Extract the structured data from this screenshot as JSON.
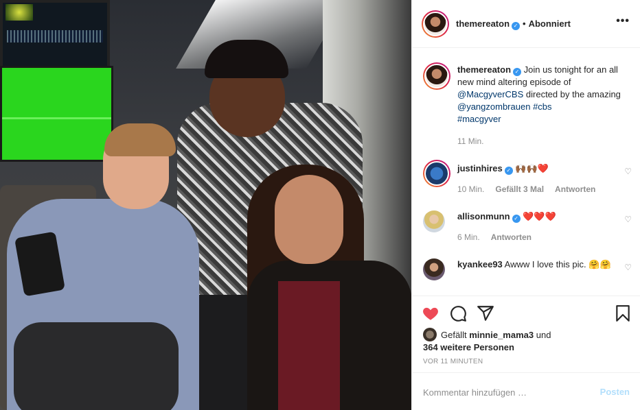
{
  "header": {
    "username": "themereaton",
    "separator": "•",
    "follow_status": "Abonniert",
    "more": "•••"
  },
  "caption": {
    "username": "themereaton",
    "text_1": " Join us tonight for an all new mind altering episode of ",
    "mention_1": "@MacgyverCBS",
    "text_2": " directed by the amazing ",
    "mention_2": "@yangzombrauen",
    "text_3": " ",
    "hashtag_1": "#cbs",
    "hashtag_2": "#macgyver",
    "time": "11 Min."
  },
  "comments": [
    {
      "username": "justinhires",
      "text": "🙌🏾🙌🏾❤️",
      "time": "10 Min.",
      "likes": "Gefällt 3 Mal",
      "reply": "Antworten"
    },
    {
      "username": "allisonmunn",
      "text": "❤️❤️❤️",
      "time": "6 Min.",
      "reply": "Antworten"
    },
    {
      "username": "kyankee93",
      "text": " Awww I love this pic. 🤗🤗"
    }
  ],
  "likes": {
    "prefix": "Gefällt ",
    "liker": "minnie_mama3",
    "mid": " und",
    "others": "364 weitere Personen"
  },
  "timestamp": "VOR 11 MINUTEN",
  "compose": {
    "placeholder": "Kommentar hinzufügen …",
    "post_label": "Posten"
  },
  "colors": {
    "like_red": "#ed4956",
    "link_blue": "#00376b",
    "verified_blue": "#3897f0",
    "post_disabled": "#b2dffc"
  },
  "icons": [
    "heart-icon",
    "comment-icon",
    "share-icon",
    "bookmark-icon",
    "verified-icon",
    "small-heart-icon",
    "more-options-icon"
  ]
}
